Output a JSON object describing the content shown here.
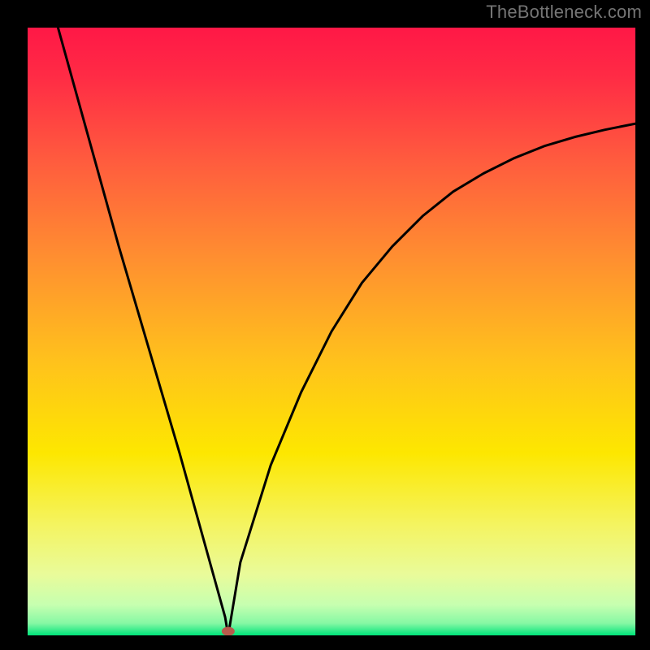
{
  "watermark": "TheBottleneck.com",
  "chart_data": {
    "type": "line",
    "title": "",
    "xlabel": "",
    "ylabel": "",
    "xlim": [
      0,
      100
    ],
    "ylim": [
      0,
      100
    ],
    "background_gradient": {
      "top_color": "#ff1846",
      "mid_colors": [
        "#ff663b",
        "#ffa22e",
        "#ffde00",
        "#f7f65a",
        "#d8ffa0"
      ],
      "bottom_color": "#00e47a"
    },
    "marker": {
      "x": 33,
      "y": 0,
      "color": "#b85a4c"
    },
    "series": [
      {
        "name": "curve",
        "x": [
          5,
          10,
          15,
          20,
          25,
          30,
          32.5,
          33,
          33.5,
          35,
          40,
          45,
          50,
          55,
          60,
          65,
          70,
          75,
          80,
          85,
          90,
          95,
          100
        ],
        "y": [
          100,
          82,
          64,
          47,
          30,
          12,
          3,
          0,
          3,
          12,
          28,
          40,
          50,
          58,
          64,
          69,
          73,
          76,
          78.5,
          80.5,
          82,
          83.2,
          84.2
        ]
      }
    ]
  }
}
